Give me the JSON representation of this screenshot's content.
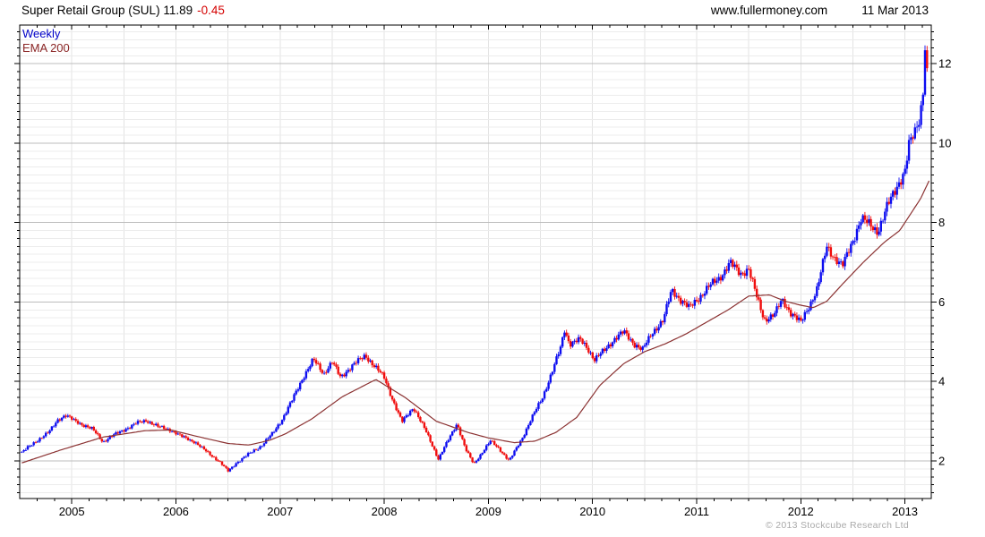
{
  "header": {
    "title": "Super Retail Group (SUL) 11.89",
    "change": "-0.45",
    "change_color": "#d40000",
    "source": "www.fullermoney.com",
    "date": "11 Mar 2013"
  },
  "legend": {
    "series": "Weekly",
    "series_color": "#0000c8",
    "overlay": "EMA 200",
    "overlay_color": "#8b2626"
  },
  "footer": {
    "copyright": "© 2013 Stockcube Research Ltd"
  },
  "chart_data": {
    "type": "candlestick",
    "title": "Super Retail Group (SUL)",
    "interval": "weekly",
    "last": {
      "price": 11.89,
      "change": -0.45,
      "date": "11 Mar 2013"
    },
    "x_axis": {
      "min": 2004.5,
      "max": 2013.253,
      "labels": [
        2005,
        2006,
        2007,
        2008,
        2009,
        2010,
        2011,
        2012,
        2013
      ],
      "gridline_step_years": 0.5,
      "minor_tick_step_years": 0.16667
    },
    "y_axis": {
      "min": 1.054,
      "max": 12.973,
      "side": "right",
      "labels": [
        2,
        4,
        6,
        8,
        10,
        12
      ],
      "minor_step": 0.2
    },
    "colors": {
      "up": "#0d0df0",
      "down": "#f00d0d",
      "ema": "#8b3232",
      "grid_minor": "#ececec",
      "grid_major": "#bdbdbd",
      "grid_vertical": "#e3e3e3",
      "axis": "#000000"
    },
    "series": [
      {
        "name": "Weekly",
        "type": "candlestick",
        "data_start": 2004.52,
        "data_end": 2013.215,
        "last_candle": {
          "open": 12.34,
          "close": 11.89,
          "high": 12.45,
          "low": 11.8
        },
        "close_anchors": [
          [
            2004.52,
            2.22
          ],
          [
            2004.6,
            2.38
          ],
          [
            2004.7,
            2.58
          ],
          [
            2004.78,
            2.72
          ],
          [
            2004.87,
            3.05
          ],
          [
            2004.94,
            3.15
          ],
          [
            2005.02,
            3.02
          ],
          [
            2005.1,
            2.92
          ],
          [
            2005.2,
            2.8
          ],
          [
            2005.3,
            2.48
          ],
          [
            2005.38,
            2.62
          ],
          [
            2005.5,
            2.78
          ],
          [
            2005.62,
            2.95
          ],
          [
            2005.72,
            3.02
          ],
          [
            2005.83,
            2.86
          ],
          [
            2005.95,
            2.78
          ],
          [
            2006.05,
            2.62
          ],
          [
            2006.18,
            2.48
          ],
          [
            2006.3,
            2.22
          ],
          [
            2006.42,
            1.98
          ],
          [
            2006.5,
            1.74
          ],
          [
            2006.58,
            1.95
          ],
          [
            2006.7,
            2.18
          ],
          [
            2006.82,
            2.38
          ],
          [
            2006.93,
            2.7
          ],
          [
            2007.02,
            3.05
          ],
          [
            2007.12,
            3.55
          ],
          [
            2007.22,
            4.1
          ],
          [
            2007.32,
            4.55
          ],
          [
            2007.42,
            4.2
          ],
          [
            2007.5,
            4.5
          ],
          [
            2007.58,
            4.1
          ],
          [
            2007.7,
            4.42
          ],
          [
            2007.82,
            4.65
          ],
          [
            2007.92,
            4.35
          ],
          [
            2008.0,
            4.1
          ],
          [
            2008.08,
            3.55
          ],
          [
            2008.17,
            2.98
          ],
          [
            2008.28,
            3.35
          ],
          [
            2008.4,
            2.75
          ],
          [
            2008.52,
            2.05
          ],
          [
            2008.62,
            2.55
          ],
          [
            2008.7,
            2.95
          ],
          [
            2008.78,
            2.3
          ],
          [
            2008.86,
            1.92
          ],
          [
            2008.95,
            2.25
          ],
          [
            2009.02,
            2.5
          ],
          [
            2009.1,
            2.32
          ],
          [
            2009.2,
            2.0
          ],
          [
            2009.32,
            2.55
          ],
          [
            2009.42,
            3.1
          ],
          [
            2009.52,
            3.6
          ],
          [
            2009.62,
            4.3
          ],
          [
            2009.7,
            4.9
          ],
          [
            2009.73,
            5.32
          ],
          [
            2009.78,
            4.95
          ],
          [
            2009.88,
            5.05
          ],
          [
            2009.95,
            4.85
          ],
          [
            2010.02,
            4.55
          ],
          [
            2010.12,
            4.8
          ],
          [
            2010.22,
            5.1
          ],
          [
            2010.3,
            5.25
          ],
          [
            2010.4,
            4.95
          ],
          [
            2010.48,
            4.8
          ],
          [
            2010.58,
            5.25
          ],
          [
            2010.68,
            5.55
          ],
          [
            2010.76,
            6.3
          ],
          [
            2010.85,
            6.05
          ],
          [
            2010.93,
            5.85
          ],
          [
            2011.02,
            6.1
          ],
          [
            2011.12,
            6.4
          ],
          [
            2011.22,
            6.6
          ],
          [
            2011.32,
            7.0
          ],
          [
            2011.42,
            6.7
          ],
          [
            2011.5,
            6.85
          ],
          [
            2011.58,
            6.1
          ],
          [
            2011.65,
            5.55
          ],
          [
            2011.75,
            5.7
          ],
          [
            2011.82,
            6.05
          ],
          [
            2011.9,
            5.75
          ],
          [
            2012.0,
            5.48
          ],
          [
            2012.08,
            5.9
          ],
          [
            2012.16,
            6.35
          ],
          [
            2012.25,
            7.4
          ],
          [
            2012.33,
            7.1
          ],
          [
            2012.4,
            6.9
          ],
          [
            2012.5,
            7.55
          ],
          [
            2012.58,
            8.1
          ],
          [
            2012.66,
            7.95
          ],
          [
            2012.74,
            7.78
          ],
          [
            2012.83,
            8.4
          ],
          [
            2012.92,
            8.9
          ],
          [
            2013.0,
            9.3
          ],
          [
            2013.04,
            9.95
          ],
          [
            2013.1,
            10.3
          ],
          [
            2013.14,
            10.65
          ],
          [
            2013.17,
            11.2
          ],
          [
            2013.205,
            12.34
          ],
          [
            2013.23,
            11.89
          ]
        ]
      },
      {
        "name": "EMA 200",
        "type": "line",
        "points": [
          [
            2004.52,
            1.95
          ],
          [
            2004.9,
            2.28
          ],
          [
            2005.3,
            2.6
          ],
          [
            2005.7,
            2.76
          ],
          [
            2005.95,
            2.78
          ],
          [
            2006.2,
            2.62
          ],
          [
            2006.5,
            2.44
          ],
          [
            2006.7,
            2.4
          ],
          [
            2006.9,
            2.52
          ],
          [
            2007.05,
            2.68
          ],
          [
            2007.3,
            3.05
          ],
          [
            2007.6,
            3.62
          ],
          [
            2007.92,
            4.05
          ],
          [
            2008.2,
            3.6
          ],
          [
            2008.5,
            3.0
          ],
          [
            2008.8,
            2.72
          ],
          [
            2009.0,
            2.58
          ],
          [
            2009.25,
            2.46
          ],
          [
            2009.45,
            2.5
          ],
          [
            2009.65,
            2.72
          ],
          [
            2009.85,
            3.1
          ],
          [
            2010.07,
            3.9
          ],
          [
            2010.3,
            4.45
          ],
          [
            2010.5,
            4.75
          ],
          [
            2010.7,
            4.95
          ],
          [
            2010.9,
            5.2
          ],
          [
            2011.1,
            5.5
          ],
          [
            2011.3,
            5.8
          ],
          [
            2011.5,
            6.15
          ],
          [
            2011.7,
            6.18
          ],
          [
            2011.85,
            6.02
          ],
          [
            2012.0,
            5.92
          ],
          [
            2012.12,
            5.86
          ],
          [
            2012.25,
            6.02
          ],
          [
            2012.4,
            6.45
          ],
          [
            2012.6,
            7.0
          ],
          [
            2012.8,
            7.5
          ],
          [
            2012.95,
            7.8
          ],
          [
            2013.05,
            8.2
          ],
          [
            2013.15,
            8.6
          ],
          [
            2013.24,
            9.1
          ]
        ]
      }
    ]
  }
}
